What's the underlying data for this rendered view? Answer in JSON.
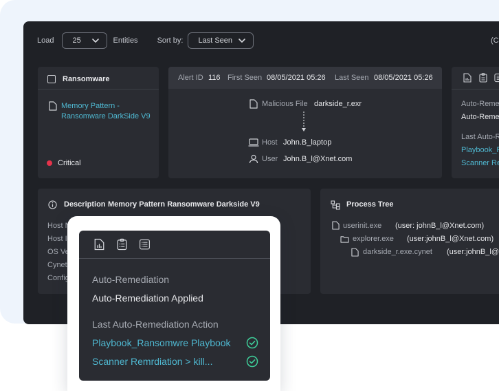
{
  "toolbar": {
    "load_label": "Load",
    "load_value": "25",
    "entities_label": "Entities",
    "sort_label": "Sort by:",
    "sort_value": "Last Seen",
    "right_cut": "(C"
  },
  "ransomware_card": {
    "title": "Ransomware",
    "pattern_name": "Memory Pattern - Ransomware DarkSide V9",
    "pattern_line1": "Memory Pattern -",
    "pattern_line2": "Ransomware DarkSide V9",
    "severity": "Critical",
    "severity_color": "#e5334b"
  },
  "alert_card": {
    "alert_id_label": "Alert ID",
    "alert_id": "116",
    "first_seen_label": "First Seen",
    "first_seen": "08/05/2021 05:26",
    "last_seen_label": "Last Seen",
    "last_seen": "08/05/2021 05:26",
    "malicious_file_label": "Malicious File",
    "malicious_file": "darkside_r.exr",
    "host_label": "Host",
    "host": "John.B_laptop",
    "user_label": "User",
    "user": "John.B_l@Xnet.com"
  },
  "remediation_card_clipped": {
    "line1": "Auto-Reme",
    "line2": "Auto-Reme",
    "line3": "Last Auto-R",
    "line4": "Playbook_R",
    "line5": "Scanner Re"
  },
  "description_card": {
    "title_label": "Description",
    "title_value": "Memory Pattern Ransomware Darkside V9",
    "rows": [
      "Host N",
      "Host I",
      "OS Ve",
      "Cynet",
      "Config"
    ]
  },
  "process_tree": {
    "title": "Process Tree",
    "nodes": [
      {
        "name": "userinit.exe",
        "user": "(user: johnB_l@Xnet.com)"
      },
      {
        "name": "explorer.exe",
        "user": "(user:johnB_l@Xnet.com)"
      },
      {
        "name": "darkside_r.exe.cynet",
        "user": "(user:johnB_l@X"
      }
    ]
  },
  "popup": {
    "auto_remediation_label": "Auto-Remediation",
    "auto_remediation_value": "Auto-Remediation Applied",
    "last_action_label": "Last Auto-Remediation Action",
    "actions": [
      "Playbook_Ransomwre Playbook",
      "Scanner Remrdiation > kill..."
    ],
    "action_status_color": "#3ecf9a"
  },
  "colors": {
    "accent_link": "#4fb8d1",
    "background_panel": "#eef4fc",
    "app_background": "#1f2126",
    "card_background": "#2a2c32"
  }
}
